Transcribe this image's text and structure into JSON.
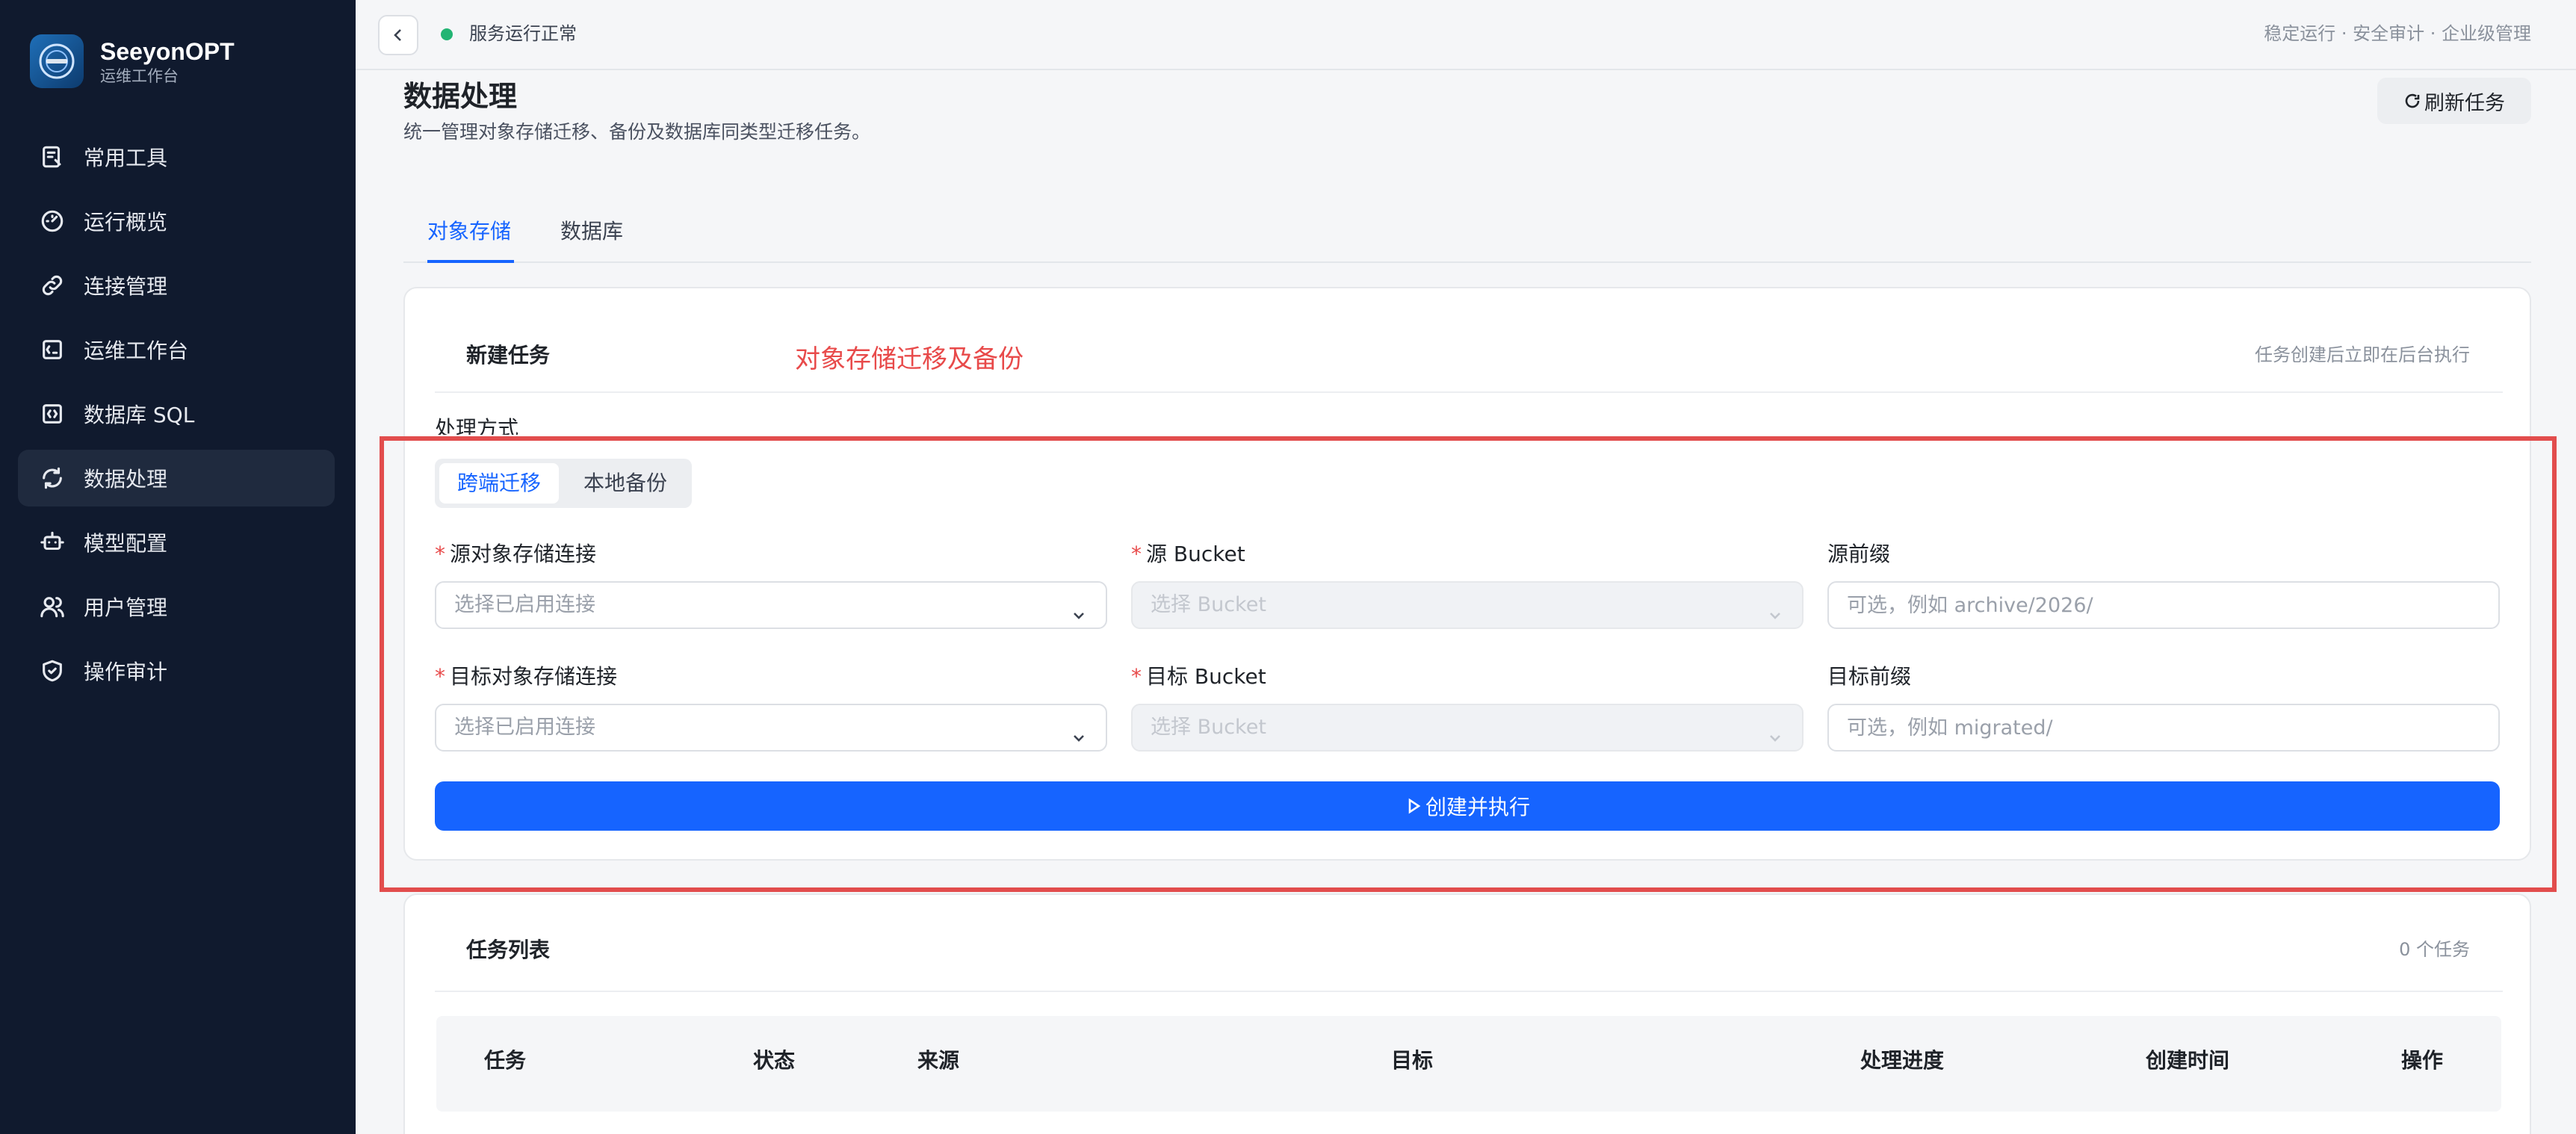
{
  "brand": {
    "title": "SeeyonOPT",
    "subtitle": "运维工作台"
  },
  "sidebar": {
    "items": [
      {
        "label": "常用工具",
        "icon": "tools-icon",
        "active": false
      },
      {
        "label": "运行概览",
        "icon": "dashboard-icon",
        "active": false
      },
      {
        "label": "连接管理",
        "icon": "link-icon",
        "active": false
      },
      {
        "label": "运维工作台",
        "icon": "terminal-icon",
        "active": false
      },
      {
        "label": "数据库 SQL",
        "icon": "code-icon",
        "active": false
      },
      {
        "label": "数据处理",
        "icon": "refresh-icon",
        "active": true
      },
      {
        "label": "模型配置",
        "icon": "robot-icon",
        "active": false
      },
      {
        "label": "用户管理",
        "icon": "users-icon",
        "active": false
      },
      {
        "label": "操作审计",
        "icon": "shield-icon",
        "active": false
      }
    ]
  },
  "topbar": {
    "status": "服务运行正常",
    "status_color": "#22b473",
    "right_text": "稳定运行 · 安全审计 · 企业级管理"
  },
  "page": {
    "title": "数据处理",
    "description": "统一管理对象存储迁移、备份及数据库同类型迁移任务。",
    "refresh_label": "刷新任务"
  },
  "tabs": [
    {
      "label": "对象存储",
      "active": true
    },
    {
      "label": "数据库",
      "active": false
    }
  ],
  "new_task": {
    "title": "新建任务",
    "hint": "任务创建后立即在后台执行",
    "annotation": "对象存储迁移及备份",
    "mode_label": "处理方式",
    "modes": [
      {
        "label": "跨端迁移",
        "active": true
      },
      {
        "label": "本地备份",
        "active": false
      }
    ],
    "fields": {
      "source_conn": {
        "label": "源对象存储连接",
        "required": true,
        "placeholder": "选择已启用连接"
      },
      "source_bucket": {
        "label": "源 Bucket",
        "required": true,
        "placeholder": "选择 Bucket"
      },
      "source_prefix": {
        "label": "源前缀",
        "required": false,
        "placeholder": "可选，例如 archive/2026/"
      },
      "target_conn": {
        "label": "目标对象存储连接",
        "required": true,
        "placeholder": "选择已启用连接"
      },
      "target_bucket": {
        "label": "目标 Bucket",
        "required": true,
        "placeholder": "选择 Bucket"
      },
      "target_prefix": {
        "label": "目标前缀",
        "required": false,
        "placeholder": "可选，例如 migrated/"
      }
    },
    "required_mark": "*",
    "submit_label": "创建并执行"
  },
  "task_list": {
    "title": "任务列表",
    "count": "0 个任务",
    "columns": [
      "任务",
      "状态",
      "来源",
      "目标",
      "处理进度",
      "创建时间",
      "操作"
    ]
  },
  "colors": {
    "accent": "#1664ff",
    "sidebar_bg": "#101a2e",
    "annotation": "#e24d4d"
  }
}
